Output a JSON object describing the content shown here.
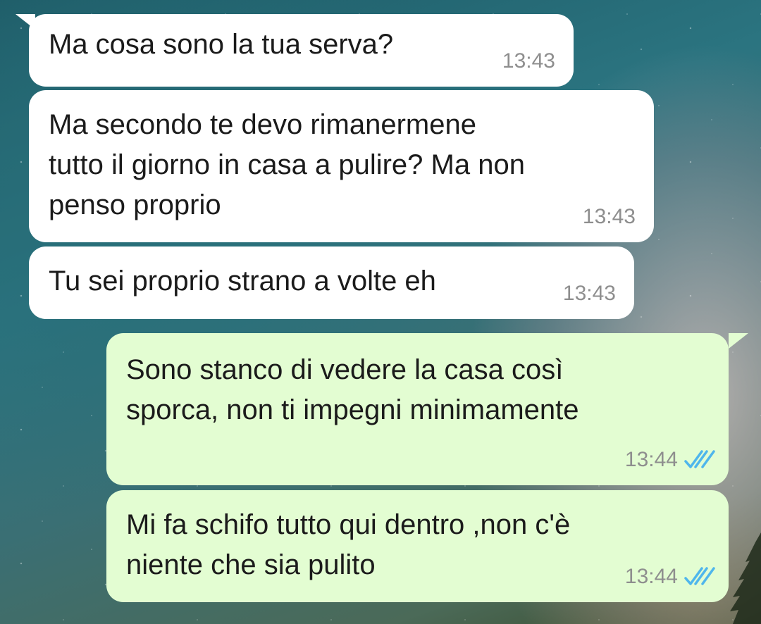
{
  "chat": {
    "messages": [
      {
        "direction": "incoming",
        "lines": [
          "Ma cosa sono la tua serva?"
        ],
        "time": "13:43"
      },
      {
        "direction": "incoming",
        "lines": [
          "Ma secondo te devo rimanermene",
          "tutto il giorno in casa a pulire? Ma non",
          "penso proprio"
        ],
        "time": "13:43"
      },
      {
        "direction": "incoming",
        "lines": [
          "Tu sei proprio strano a volte eh"
        ],
        "time": "13:43"
      },
      {
        "direction": "outgoing",
        "lines": [
          "Sono stanco di vedere la casa così",
          "sporca, non ti impegni minimamente"
        ],
        "time": "13:44",
        "status_icon": "double-check-read-icon"
      },
      {
        "direction": "outgoing",
        "lines": [
          "Mi fa schifo tutto qui dentro ,non c'è",
          "niente che sia pulito"
        ],
        "time": "13:44",
        "status_icon": "double-check-read-icon"
      }
    ]
  },
  "colors": {
    "incoming_bubble": "#ffffff",
    "outgoing_bubble": "#e3fdd2",
    "timestamp": "#8e8e8e",
    "read_ticks": "#4fb6ec"
  },
  "wallpaper": "starry-night-sky"
}
